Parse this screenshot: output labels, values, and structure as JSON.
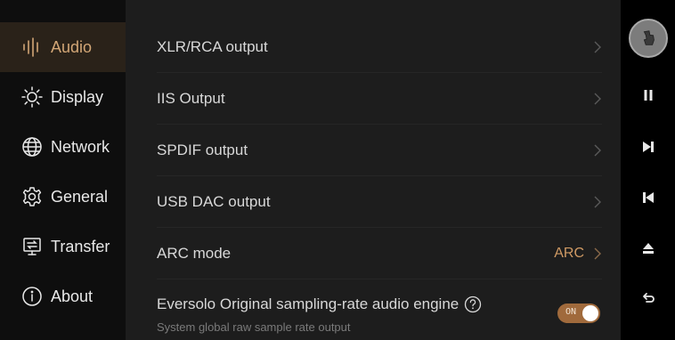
{
  "sidebar": {
    "items": [
      {
        "label": "Audio",
        "icon": "audio-bars-icon",
        "active": true
      },
      {
        "label": "Display",
        "icon": "sun-icon",
        "active": false
      },
      {
        "label": "Network",
        "icon": "globe-icon",
        "active": false
      },
      {
        "label": "General",
        "icon": "gear-icon",
        "active": false
      },
      {
        "label": "Transfer",
        "icon": "transfer-icon",
        "active": false
      },
      {
        "label": "About",
        "icon": "info-icon",
        "active": false
      }
    ]
  },
  "main": {
    "rows": [
      {
        "label": "XLR/RCA output",
        "value": ""
      },
      {
        "label": "IIS Output",
        "value": ""
      },
      {
        "label": "SPDIF output",
        "value": ""
      },
      {
        "label": "USB DAC output",
        "value": ""
      },
      {
        "label": "ARC mode",
        "value": "ARC"
      }
    ],
    "engine": {
      "label": "Eversolo Original sampling-rate audio engine",
      "sub": "System global raw sample rate output",
      "toggle_text": "ON",
      "toggle_on": true
    }
  },
  "controls": {
    "avatar_icon": "hand-icon",
    "buttons": [
      "pause-icon",
      "next-icon",
      "previous-icon",
      "eject-icon",
      "back-icon"
    ]
  },
  "colors": {
    "accent": "#d09a64",
    "active_bg": "#2a2219",
    "toggle_bg": "#a06a3c",
    "panel_bg": "#1d1d1d"
  }
}
